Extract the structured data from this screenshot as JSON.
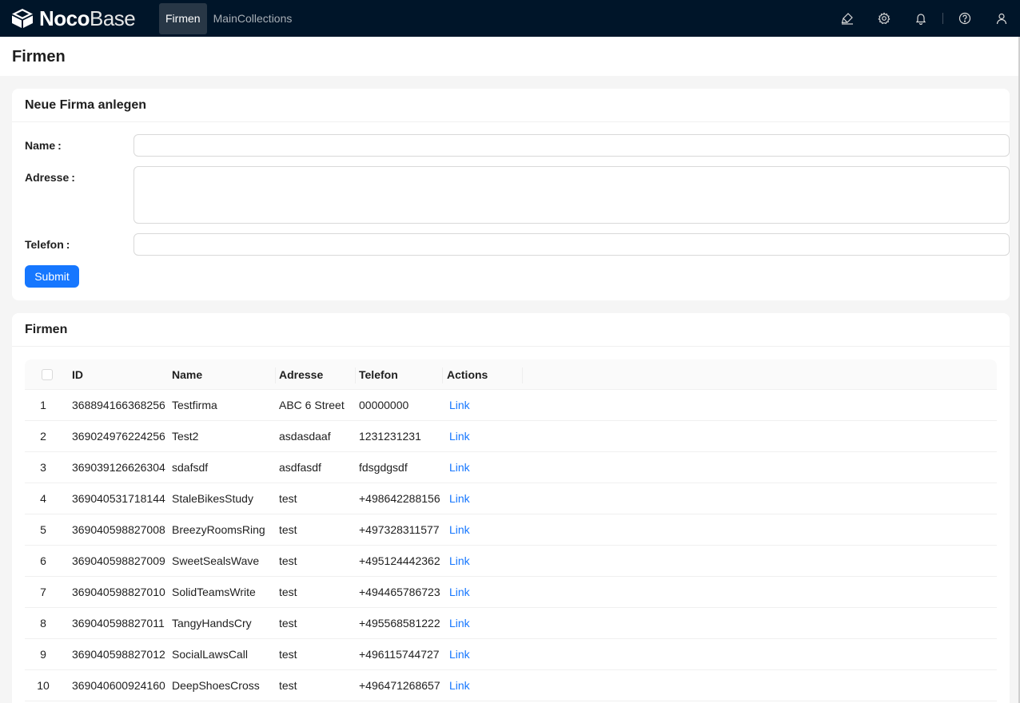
{
  "app": {
    "logo_bold": "Noco",
    "logo_light": "Base",
    "nav": [
      {
        "label": "Firmen",
        "active": true
      },
      {
        "label": "MainCollections",
        "active": false
      }
    ],
    "icons": [
      "highlighter-icon",
      "gear-icon",
      "bell-icon",
      "help-icon",
      "user-icon"
    ]
  },
  "page": {
    "title": "Firmen"
  },
  "form": {
    "title": "Neue Firma anlegen",
    "fields": [
      {
        "label": "Name",
        "colon": ":",
        "value": ""
      },
      {
        "label": "Adresse",
        "colon": ":",
        "value": ""
      },
      {
        "label": "Telefon",
        "colon": ":",
        "value": ""
      }
    ],
    "submit_label": "Submit"
  },
  "table": {
    "title": "Firmen",
    "columns": [
      "ID",
      "Name",
      "Adresse",
      "Telefon",
      "Actions"
    ],
    "rows": [
      {
        "n": "1",
        "id": "368894166368256",
        "name": "Testfirma",
        "adresse": "ABC 6 Street",
        "telefon": "00000000",
        "action": "Link"
      },
      {
        "n": "2",
        "id": "369024976224256",
        "name": "Test2",
        "adresse": "asdasdaaf",
        "telefon": "1231231231",
        "action": "Link"
      },
      {
        "n": "3",
        "id": "369039126626304",
        "name": "sdafsdf",
        "adresse": "asdfasdf",
        "telefon": "fdsgdgsdf",
        "action": "Link"
      },
      {
        "n": "4",
        "id": "369040531718144",
        "name": "StaleBikesStudy",
        "adresse": "test",
        "telefon": "+498642288156",
        "action": "Link"
      },
      {
        "n": "5",
        "id": "369040598827008",
        "name": "BreezyRoomsRing",
        "adresse": "test",
        "telefon": "+497328311577",
        "action": "Link"
      },
      {
        "n": "6",
        "id": "369040598827009",
        "name": "SweetSealsWave",
        "adresse": "test",
        "telefon": "+495124442362",
        "action": "Link"
      },
      {
        "n": "7",
        "id": "369040598827010",
        "name": "SolidTeamsWrite",
        "adresse": "test",
        "telefon": "+494465786723",
        "action": "Link"
      },
      {
        "n": "8",
        "id": "369040598827011",
        "name": "TangyHandsCry",
        "adresse": "test",
        "telefon": "+495568581222",
        "action": "Link"
      },
      {
        "n": "9",
        "id": "369040598827012",
        "name": "SocialLawsCall",
        "adresse": "test",
        "telefon": "+496115744727",
        "action": "Link"
      },
      {
        "n": "10",
        "id": "369040600924160",
        "name": "DeepShoesCross",
        "adresse": "test",
        "telefon": "+496471268657",
        "action": "Link"
      }
    ]
  },
  "colors": {
    "header_bg": "#001529",
    "primary": "#1677ff",
    "page_bg": "#f5f5f5"
  }
}
